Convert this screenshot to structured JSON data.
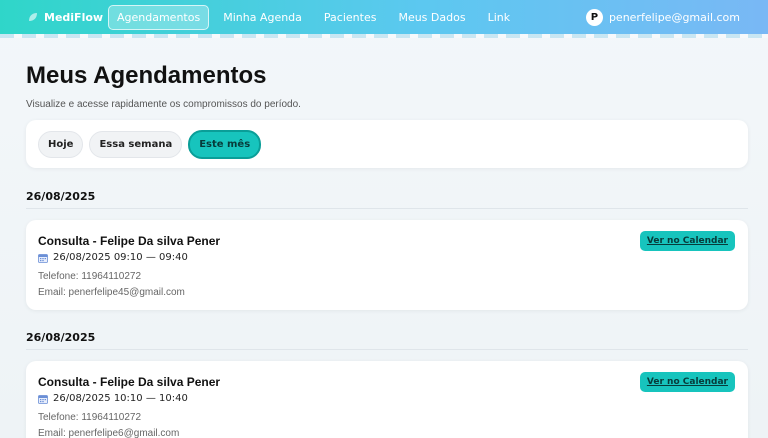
{
  "brand": {
    "name": "MediFlow",
    "icon": "leaf-icon"
  },
  "nav": {
    "items": [
      {
        "label": "Agendamentos",
        "active": true
      },
      {
        "label": "Minha Agenda",
        "active": false
      },
      {
        "label": "Pacientes",
        "active": false
      },
      {
        "label": "Meus Dados",
        "active": false
      },
      {
        "label": "Link",
        "active": false
      }
    ]
  },
  "user": {
    "initial": "P",
    "email": "penerfelipe@gmail.com"
  },
  "page": {
    "title": "Meus Agendamentos",
    "subtitle": "Visualize e acesse rapidamente os compromissos do período."
  },
  "filters": [
    {
      "label": "Hoje",
      "active": false
    },
    {
      "label": "Essa semana",
      "active": false
    },
    {
      "label": "Este mês",
      "active": true
    }
  ],
  "groups": [
    {
      "date": "26/08/2025",
      "appointment": {
        "title": "Consulta - Felipe Da silva Pener",
        "time": "26/08/2025 09:10 — 09:40",
        "phone": "Telefone: 11964110272",
        "email": "Email: penerfelipe45@gmail.com",
        "button": "Ver no Calendar"
      }
    },
    {
      "date": "26/08/2025",
      "appointment": {
        "title": "Consulta - Felipe Da silva Pener",
        "time": "26/08/2025 10:10 — 10:40",
        "phone": "Telefone: 11964110272",
        "email": "Email: penerfelipe6@gmail.com",
        "button": "Ver no Calendar"
      }
    }
  ],
  "colors": {
    "accent": "#17c4bd",
    "nav_start": "#2fd6c9",
    "nav_end": "#79b8f5"
  }
}
